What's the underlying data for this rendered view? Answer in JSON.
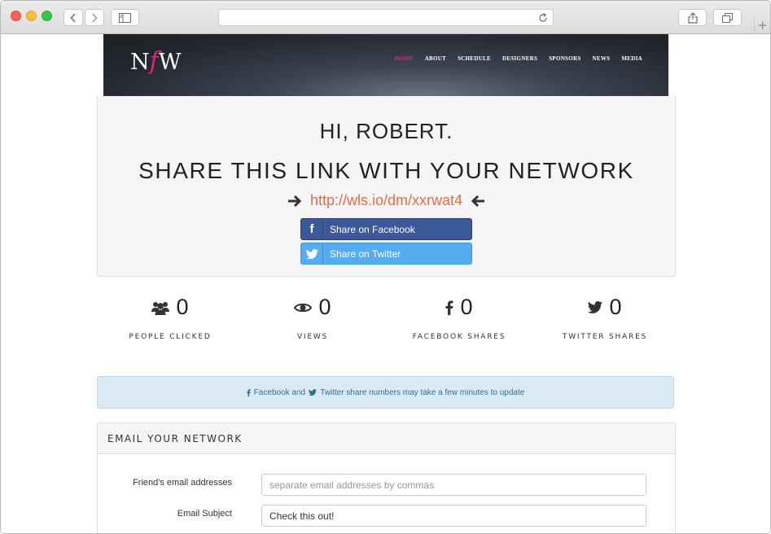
{
  "browser": {
    "address": "",
    "new_tab_symbol": "+"
  },
  "site": {
    "logo_left": "N",
    "logo_mid": "f",
    "logo_right": "W",
    "nav": [
      "HOME",
      "ABOUT",
      "SCHEDULE",
      "DESIGNERS",
      "SPONSORS",
      "NEWS",
      "MEDIA"
    ],
    "nav_active": "HOME"
  },
  "share": {
    "greeting": "HI, ROBERT.",
    "title": "SHARE THIS LINK WITH YOUR NETWORK",
    "url": "http://wls.io/dm/xxrwat4",
    "facebook_label": "Share on Facebook",
    "twitter_label": "Share on Twitter",
    "facebook_color": "#3b5998",
    "twitter_color": "#55acee",
    "link_color": "#e06f49"
  },
  "stats": [
    {
      "icon": "users-icon",
      "value": "0",
      "label": "PEOPLE CLICKED"
    },
    {
      "icon": "eye-icon",
      "value": "0",
      "label": "VIEWS"
    },
    {
      "icon": "facebook-icon",
      "value": "0",
      "label": "FACEBOOK SHARES"
    },
    {
      "icon": "twitter-icon",
      "value": "0",
      "label": "TWITTER SHARES"
    }
  ],
  "notice": {
    "part1": "Facebook and",
    "part2": "Twitter share numbers may take a few minutes to update"
  },
  "email": {
    "heading": "EMAIL YOUR NETWORK",
    "friends_label": "Friend's email addresses",
    "friends_placeholder": "separate email addresses by commas",
    "subject_label": "Email Subject",
    "subject_value": "Check this out!"
  }
}
